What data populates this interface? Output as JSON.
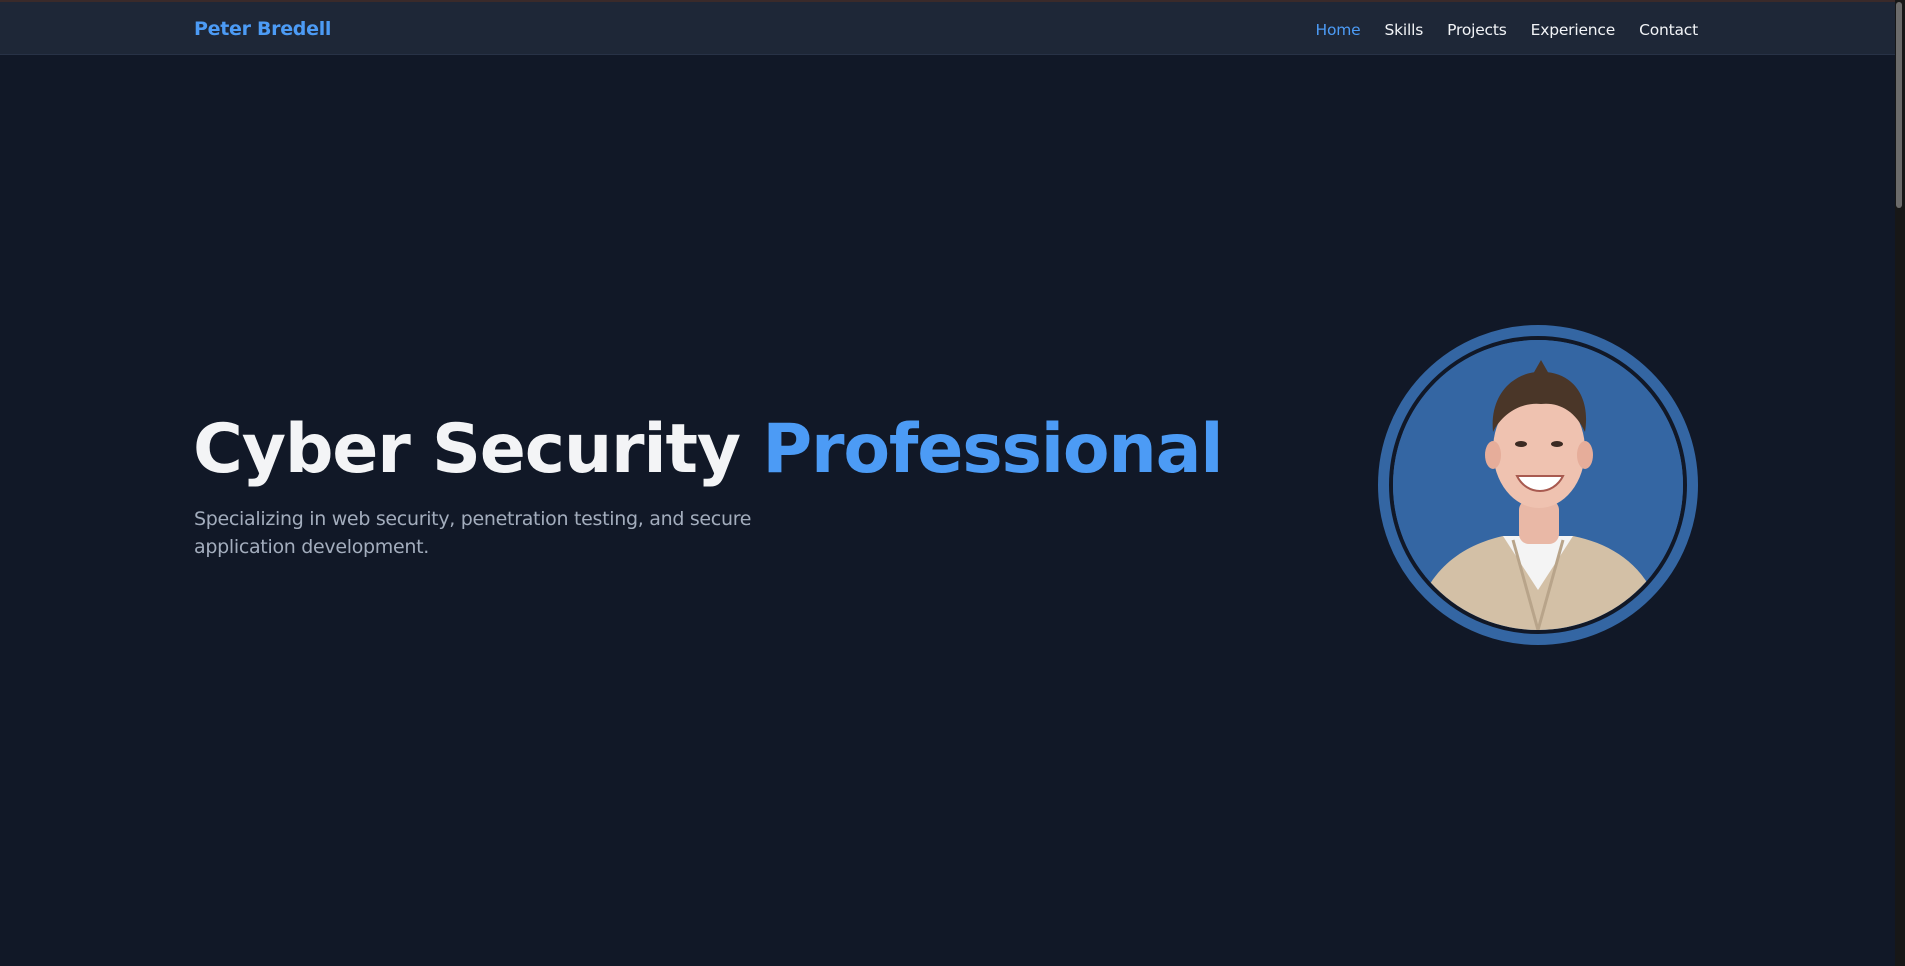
{
  "nav": {
    "brand": "Peter Bredell",
    "items": [
      {
        "label": "Home",
        "active": true
      },
      {
        "label": "Skills",
        "active": false
      },
      {
        "label": "Projects",
        "active": false
      },
      {
        "label": "Experience",
        "active": false
      },
      {
        "label": "Contact",
        "active": false
      }
    ]
  },
  "hero": {
    "title_main": "Cyber Security ",
    "title_accent": "Professional",
    "subtitle": "Specializing in web security, penetration testing, and secure application development."
  },
  "profile_image": {
    "icon": "profile-photo"
  },
  "colors": {
    "background": "#111827",
    "navbar": "#1e2737",
    "accent": "#4c9bf5",
    "text": "#f3f4f6",
    "muted": "#a3adbd",
    "avatar_bg": "#3466a3"
  }
}
